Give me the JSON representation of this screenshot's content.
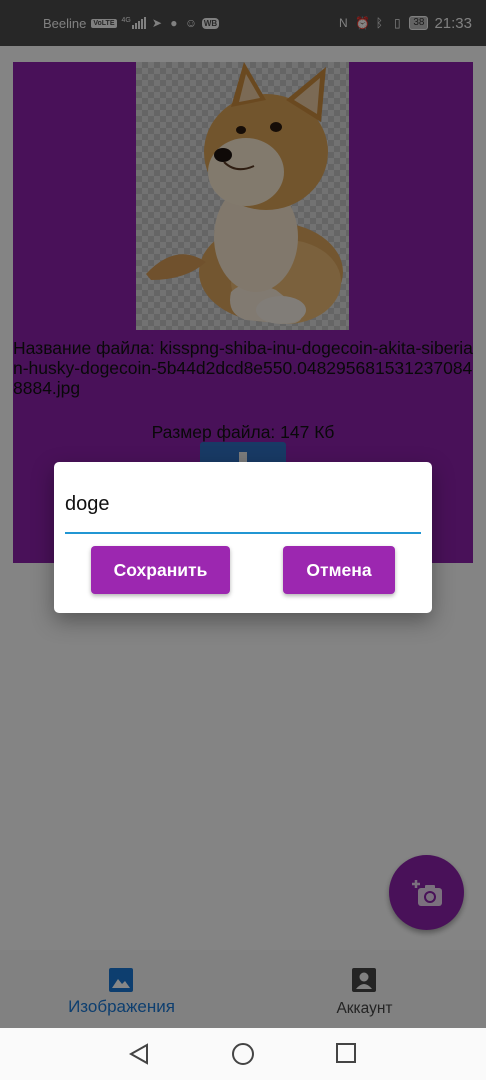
{
  "status_bar": {
    "carrier": "Beeline",
    "volte": "VoLTE",
    "network": "4G",
    "battery": "38",
    "time": "21:33"
  },
  "card": {
    "file_name": "Название файла: kisspng-shiba-inu-dogecoin-akita-siberian-husky-dogecoin-5b44d2dcd8e550.0482956815312370848884.jpg",
    "file_size": "Размер файла: 147 Кб"
  },
  "dialog": {
    "input_value": "doge",
    "save_label": "Сохранить",
    "cancel_label": "Отмена"
  },
  "bottom_nav": {
    "items": [
      {
        "label": "Изображения",
        "icon": "image-icon",
        "active": true
      },
      {
        "label": "Аккаунт",
        "icon": "account-icon",
        "active": false
      }
    ]
  },
  "colors": {
    "primary": "#9c27b0",
    "accent_blue": "#1976d2",
    "input_underline": "#2196d3"
  }
}
